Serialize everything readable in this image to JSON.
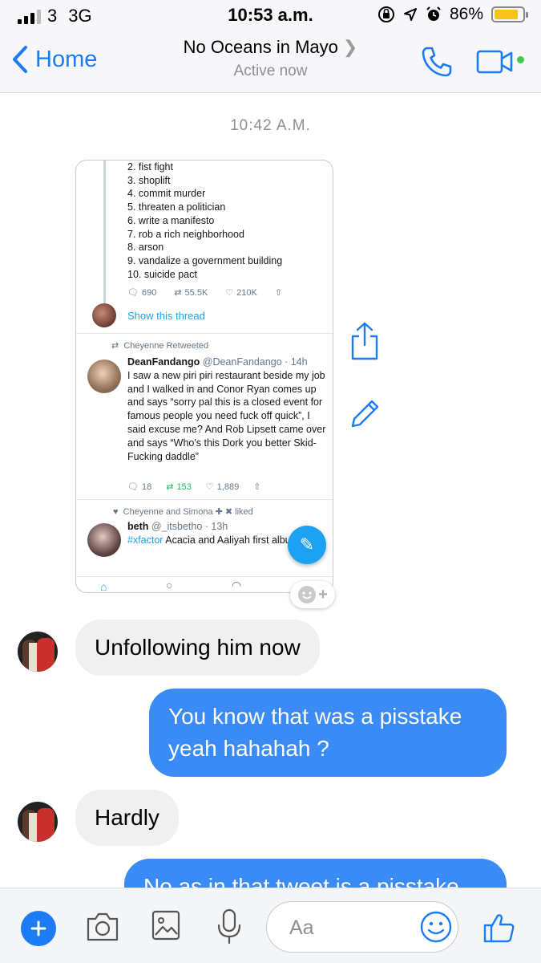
{
  "status_bar": {
    "carrier": "3",
    "network": "3G",
    "time": "10:53 a.m.",
    "battery": "86%",
    "battery_level": 0.86
  },
  "header": {
    "back_label": "Home",
    "title": "No Oceans in Mayo",
    "subtitle": "Active now",
    "accent_color": "#1b7cf5"
  },
  "conversation": {
    "timestamp": "10:42 A.M.",
    "shared_screenshot": {
      "list_items": [
        "2. fist fight",
        "3. shoplift",
        "4. commit murder",
        "5. threaten a politician",
        "6. write a manifesto",
        "7.  rob a rich neighborhood",
        "8. arson",
        "9. vandalize a government building",
        "10. suicide pact"
      ],
      "tweet1_actions": {
        "replies": "690",
        "retweets": "55.5K",
        "likes": "210K"
      },
      "show_thread": "Show this thread",
      "retweeted_by": "Cheyenne Retweeted",
      "tweet2": {
        "name": "DeanFandango",
        "handle": "@DeanFandango · 14h",
        "text": "I saw a new piri piri restaurant beside my job and I walked in and Conor Ryan comes up and says “sorry pal this is a closed event for famous people you need fuck off quick”, I said excuse me? And Rob Lipsett came over and says “Who's this Dork you better Skid-Fucking daddle”",
        "replies": "18",
        "retweets": "153",
        "likes": "1,889"
      },
      "liked_by": "Cheyenne and Simona ✚ ✖ liked",
      "tweet3": {
        "name": "beth",
        "handle": "@_itsbetho · 13h",
        "hashtag": "#xfactor",
        "text": "Acacia and Aaliyah first album"
      }
    },
    "messages": [
      {
        "direction": "in",
        "text": "Unfollowing him now"
      },
      {
        "direction": "out",
        "text": "You know that was a pisstake yeah hahahah ?"
      },
      {
        "direction": "in",
        "text": "Hardly"
      },
      {
        "direction": "out",
        "text": "No as in that tweet is a pisstake"
      }
    ]
  },
  "composer": {
    "placeholder": "Aa",
    "icons": [
      "plus-icon",
      "camera-icon",
      "gallery-icon",
      "microphone-icon",
      "emoji-icon",
      "thumbs-up-icon"
    ]
  }
}
